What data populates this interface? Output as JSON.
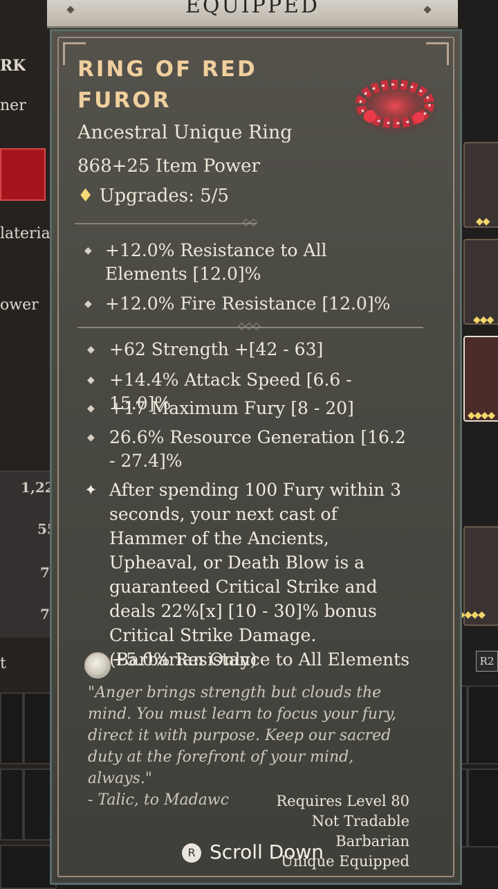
{
  "header": {
    "tab_label": "EQUIPPED"
  },
  "left_panel": {
    "labels": [
      "RK",
      "ner",
      "lateria",
      "ower",
      "t"
    ],
    "numbers": [
      "1,22",
      "55",
      "7",
      "7"
    ]
  },
  "item": {
    "name": "RING OF RED FUROR",
    "type": "Ancestral Unique Ring",
    "item_power": "868+25 Item Power",
    "upgrades_icon": "♦",
    "upgrades": "Upgrades: 5/5",
    "implicits": [
      "+12.0% Resistance to All Elements [12.0]%",
      "+12.0% Fire Resistance [12.0]%"
    ],
    "affixes": [
      "+62 Strength +[42 - 63]",
      "+14.4% Attack Speed [6.6 - 15.0]%",
      "+17 Maximum Fury [8 - 20]",
      "26.6% Resource Generation [16.2 - 27.4]%"
    ],
    "unique_power": "After spending 100 Fury within 3 seconds, your next cast of Hammer of the Ancients, Upheaval, or Death Blow is a guaranteed Critical Strike and deals 22%[x] [10 - 30]% bonus Critical Strike Damage. (Barbarian Only)",
    "socket": "+5.0% Resistance to All Elements",
    "flavor": "\"Anger brings strength but clouds the mind. You must learn to focus your fury, direct it with purpose. Keep our sacred duty at the forefront of your mind, always.\"",
    "flavor_attribution": "- Talic, to Madawc",
    "requirements": [
      "Requires Level 80",
      "Not Tradable",
      "Barbarian",
      "Unique Equipped"
    ]
  },
  "footer": {
    "scroll_key": "R",
    "scroll_label": "Scroll Down"
  },
  "right_panel": {
    "button_label": "R2"
  },
  "colors": {
    "title": "#f0cf9e",
    "card_bg": "#4a4a43",
    "accent_red": "#a5161c"
  }
}
